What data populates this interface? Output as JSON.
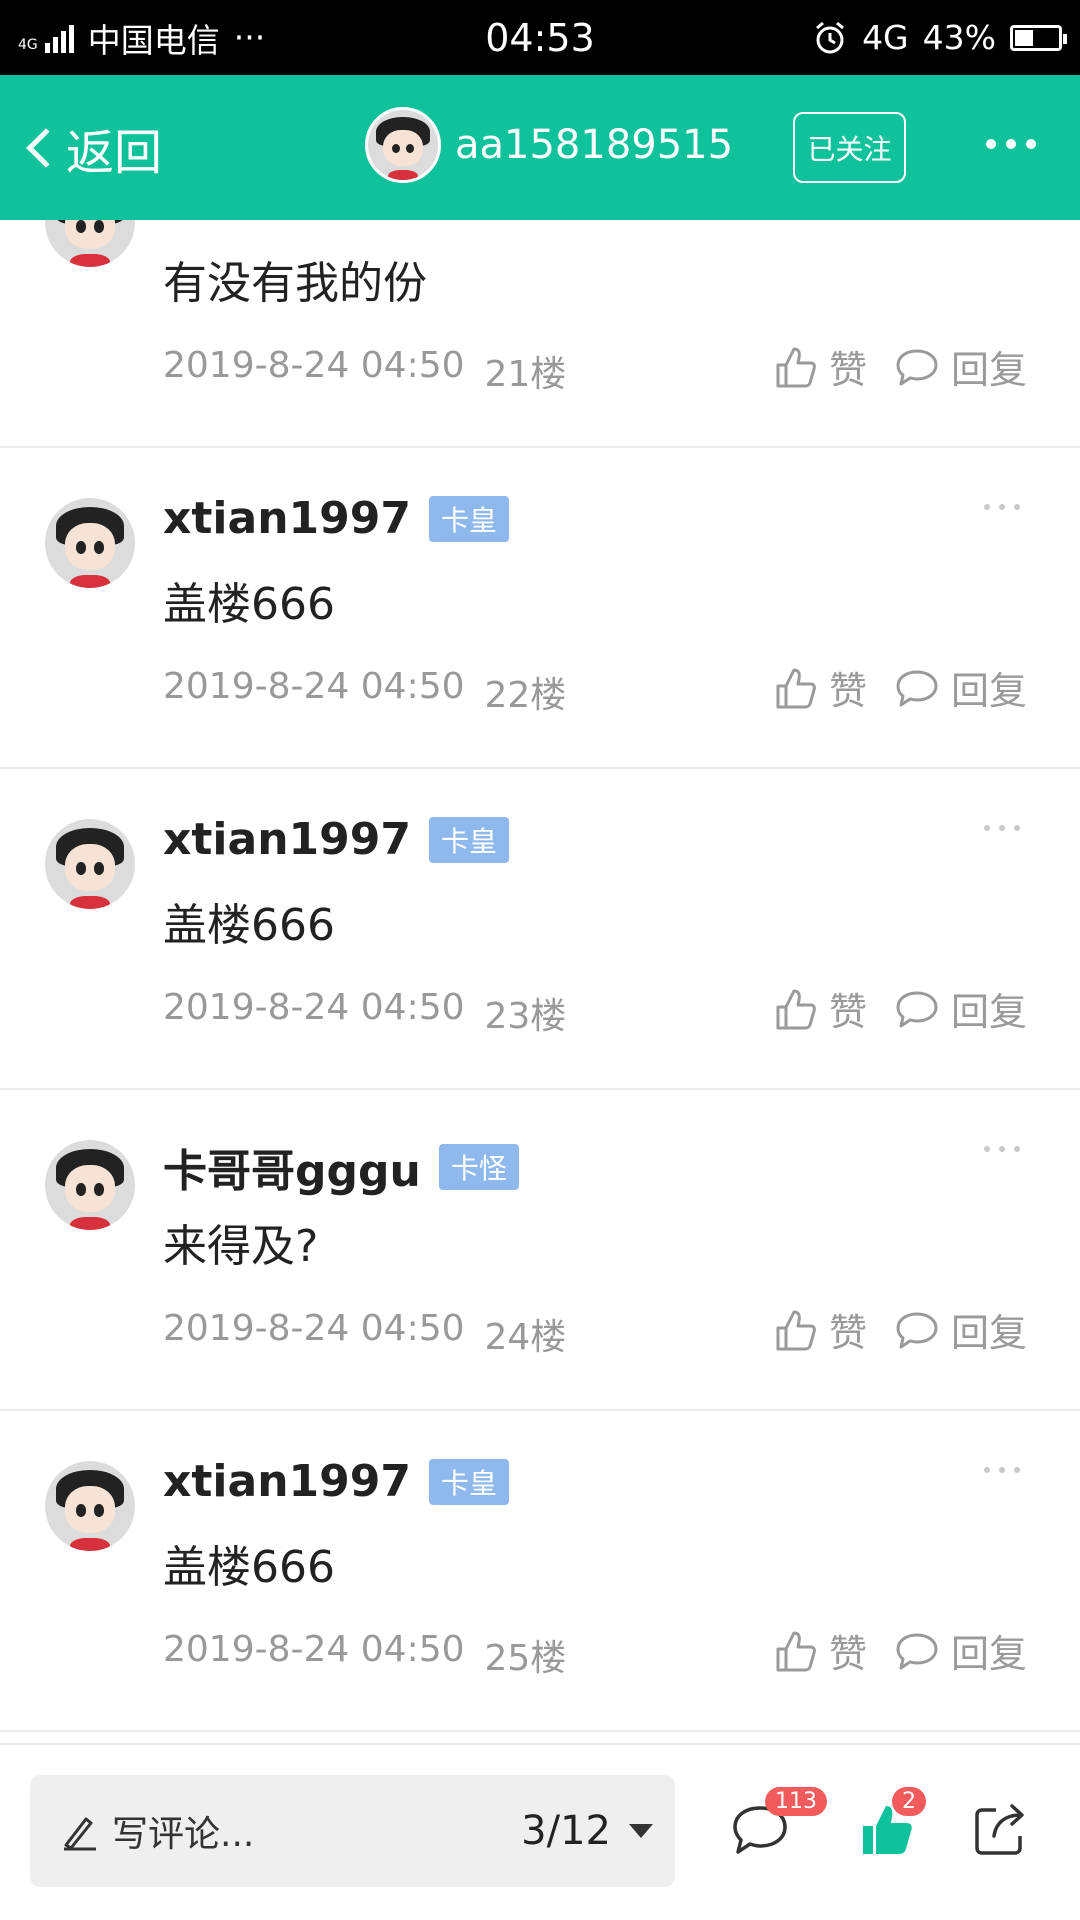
{
  "status_bar": {
    "network": "4G",
    "carrier": "中国电信",
    "more": "···",
    "time": "04:53",
    "data_type": "4G",
    "battery": "43%"
  },
  "header": {
    "back_label": "返回",
    "username": "aa158189515",
    "follow_label": "已关注"
  },
  "comments": [
    {
      "username": "",
      "badge": "",
      "text": "有没有我的份",
      "time": "2019-8-24 04:50",
      "floor": "21楼",
      "like_label": "赞",
      "reply_label": "回复"
    },
    {
      "username": "xtian1997",
      "badge": "卡皇",
      "text": "盖楼666",
      "time": "2019-8-24 04:50",
      "floor": "22楼",
      "like_label": "赞",
      "reply_label": "回复"
    },
    {
      "username": "xtian1997",
      "badge": "卡皇",
      "text": "盖楼666",
      "time": "2019-8-24 04:50",
      "floor": "23楼",
      "like_label": "赞",
      "reply_label": "回复"
    },
    {
      "username": "卡哥哥gggu",
      "badge": "卡怪",
      "text": "来得及?",
      "time": "2019-8-24 04:50",
      "floor": "24楼",
      "like_label": "赞",
      "reply_label": "回复"
    },
    {
      "username": "xtian1997",
      "badge": "卡皇",
      "text": "盖楼666",
      "time": "2019-8-24 04:50",
      "floor": "25楼",
      "like_label": "赞",
      "reply_label": "回复"
    }
  ],
  "bottom_bar": {
    "input_placeholder": "写评论...",
    "page_indicator": "3/12",
    "comment_count": "113",
    "like_count": "2"
  },
  "colors": {
    "accent": "#10c29b",
    "badge": "#8fb8ec",
    "count_badge": "#f25b5b"
  }
}
